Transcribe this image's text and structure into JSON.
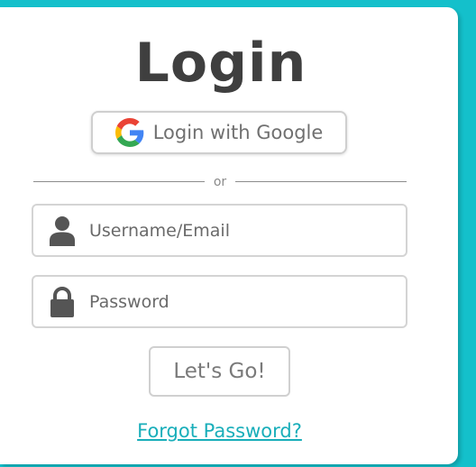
{
  "login_card": {
    "title": "Login",
    "google_button": {
      "label": "Login with Google",
      "icon": "google-g-icon"
    },
    "divider_text": "or",
    "username_field": {
      "placeholder": "Username/Email",
      "value": "",
      "icon": "user-icon"
    },
    "password_field": {
      "placeholder": "Password",
      "value": "",
      "icon": "lock-icon"
    },
    "submit_label": "Let's Go!",
    "forgot_password_label": "Forgot Password?"
  },
  "colors": {
    "background": "#14c0cb",
    "card": "#ffffff",
    "title": "#3f3f3f",
    "link": "#19aeba",
    "icon": "#555555"
  }
}
